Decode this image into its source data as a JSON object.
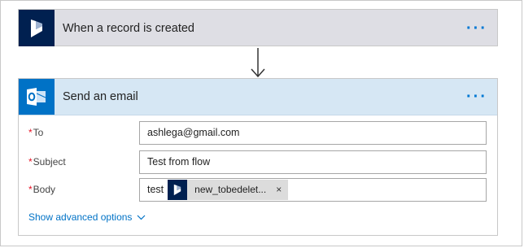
{
  "trigger": {
    "title": "When a record is created",
    "more_label": "···",
    "icon": "dynamics-icon"
  },
  "connector": {
    "icon": "arrow-down-icon"
  },
  "action": {
    "title": "Send an email",
    "more_label": "···",
    "icon": "outlook-icon",
    "fields": {
      "to": {
        "label": "To",
        "required": "*",
        "value": "ashlega@gmail.com"
      },
      "subject": {
        "label": "Subject",
        "required": "*",
        "value": "Test from flow"
      },
      "body": {
        "label": "Body",
        "required": "*",
        "text": "test",
        "token": {
          "label": "new_tobedelet...",
          "icon": "dynamics-icon",
          "close": "×"
        }
      }
    },
    "advanced_label": "Show advanced options",
    "advanced_icon": "chevron-down-icon"
  },
  "colors": {
    "dynamics": "#002050",
    "outlook": "#0072c6",
    "accent": "#0078d4",
    "required": "#e81123"
  }
}
